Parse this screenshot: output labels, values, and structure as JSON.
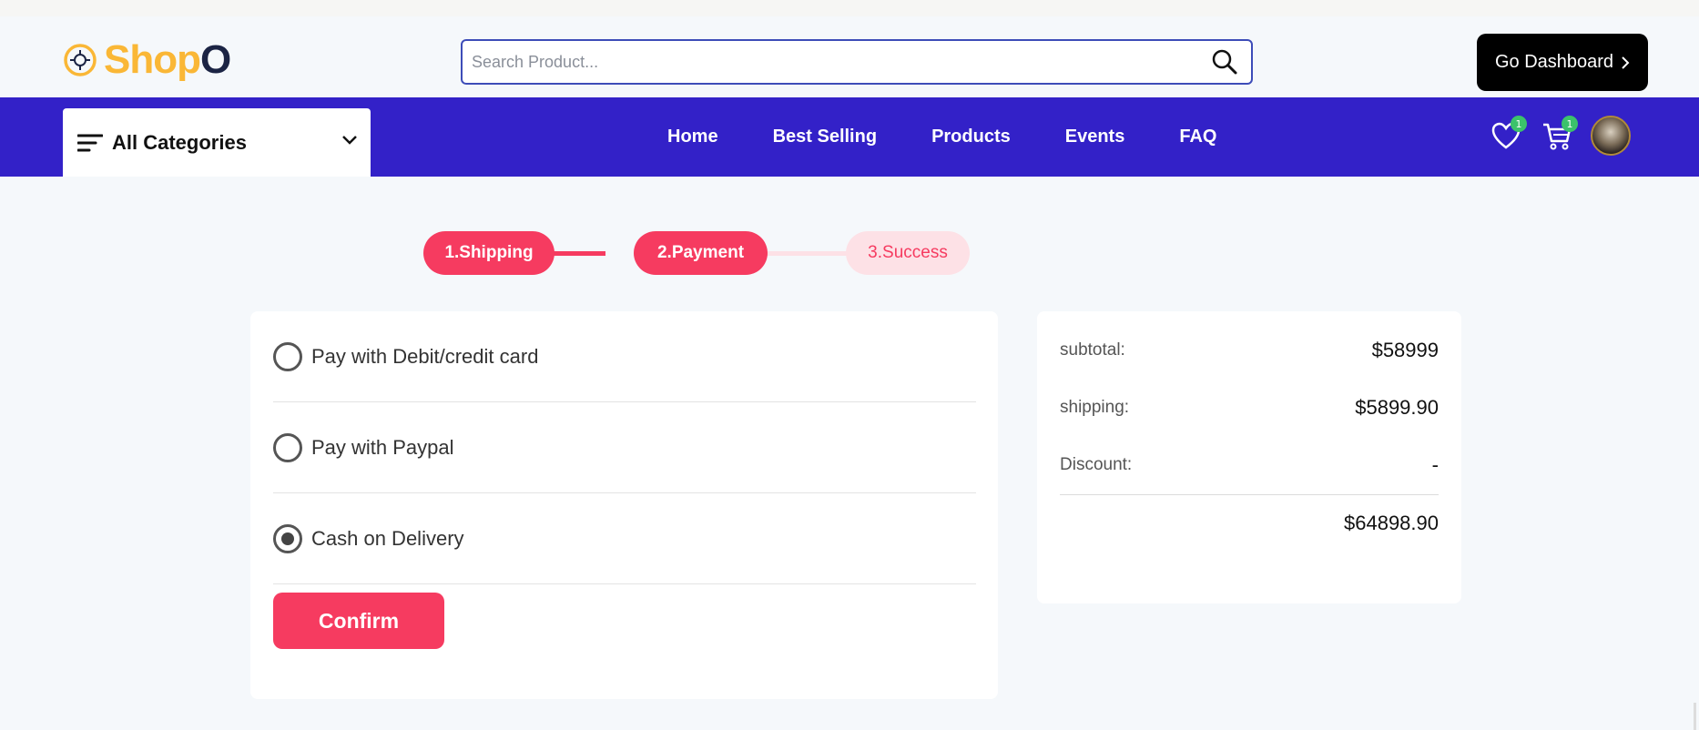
{
  "brand": {
    "name_main": "Shop",
    "name_tail": "O",
    "colors": {
      "accent": "#fab736",
      "dark": "#1b2444"
    }
  },
  "header": {
    "search_placeholder": "Search Product...",
    "dashboard_label": "Go Dashboard"
  },
  "nav": {
    "background": "#3321c8",
    "categories_label": "All Categories",
    "links": [
      "Home",
      "Best Selling",
      "Products",
      "Events",
      "FAQ"
    ],
    "wishlist_count": "1",
    "cart_count": "1"
  },
  "steps": [
    {
      "label": "1.Shipping",
      "state": "active"
    },
    {
      "label": "2.Payment",
      "state": "active"
    },
    {
      "label": "3.Success",
      "state": "inactive"
    }
  ],
  "payment": {
    "options": [
      {
        "label": "Pay with Debit/credit card",
        "checked": false
      },
      {
        "label": "Pay with Paypal",
        "checked": false
      },
      {
        "label": "Cash on Delivery",
        "checked": true
      }
    ],
    "confirm_label": "Confirm",
    "accent": "#f63b60"
  },
  "summary": {
    "subtotal_label": "subtotal:",
    "subtotal_value": "$58999",
    "shipping_label": "shipping:",
    "shipping_value": "$5899.90",
    "discount_label": "Discount:",
    "discount_value": "-",
    "total_value": "$64898.90"
  }
}
